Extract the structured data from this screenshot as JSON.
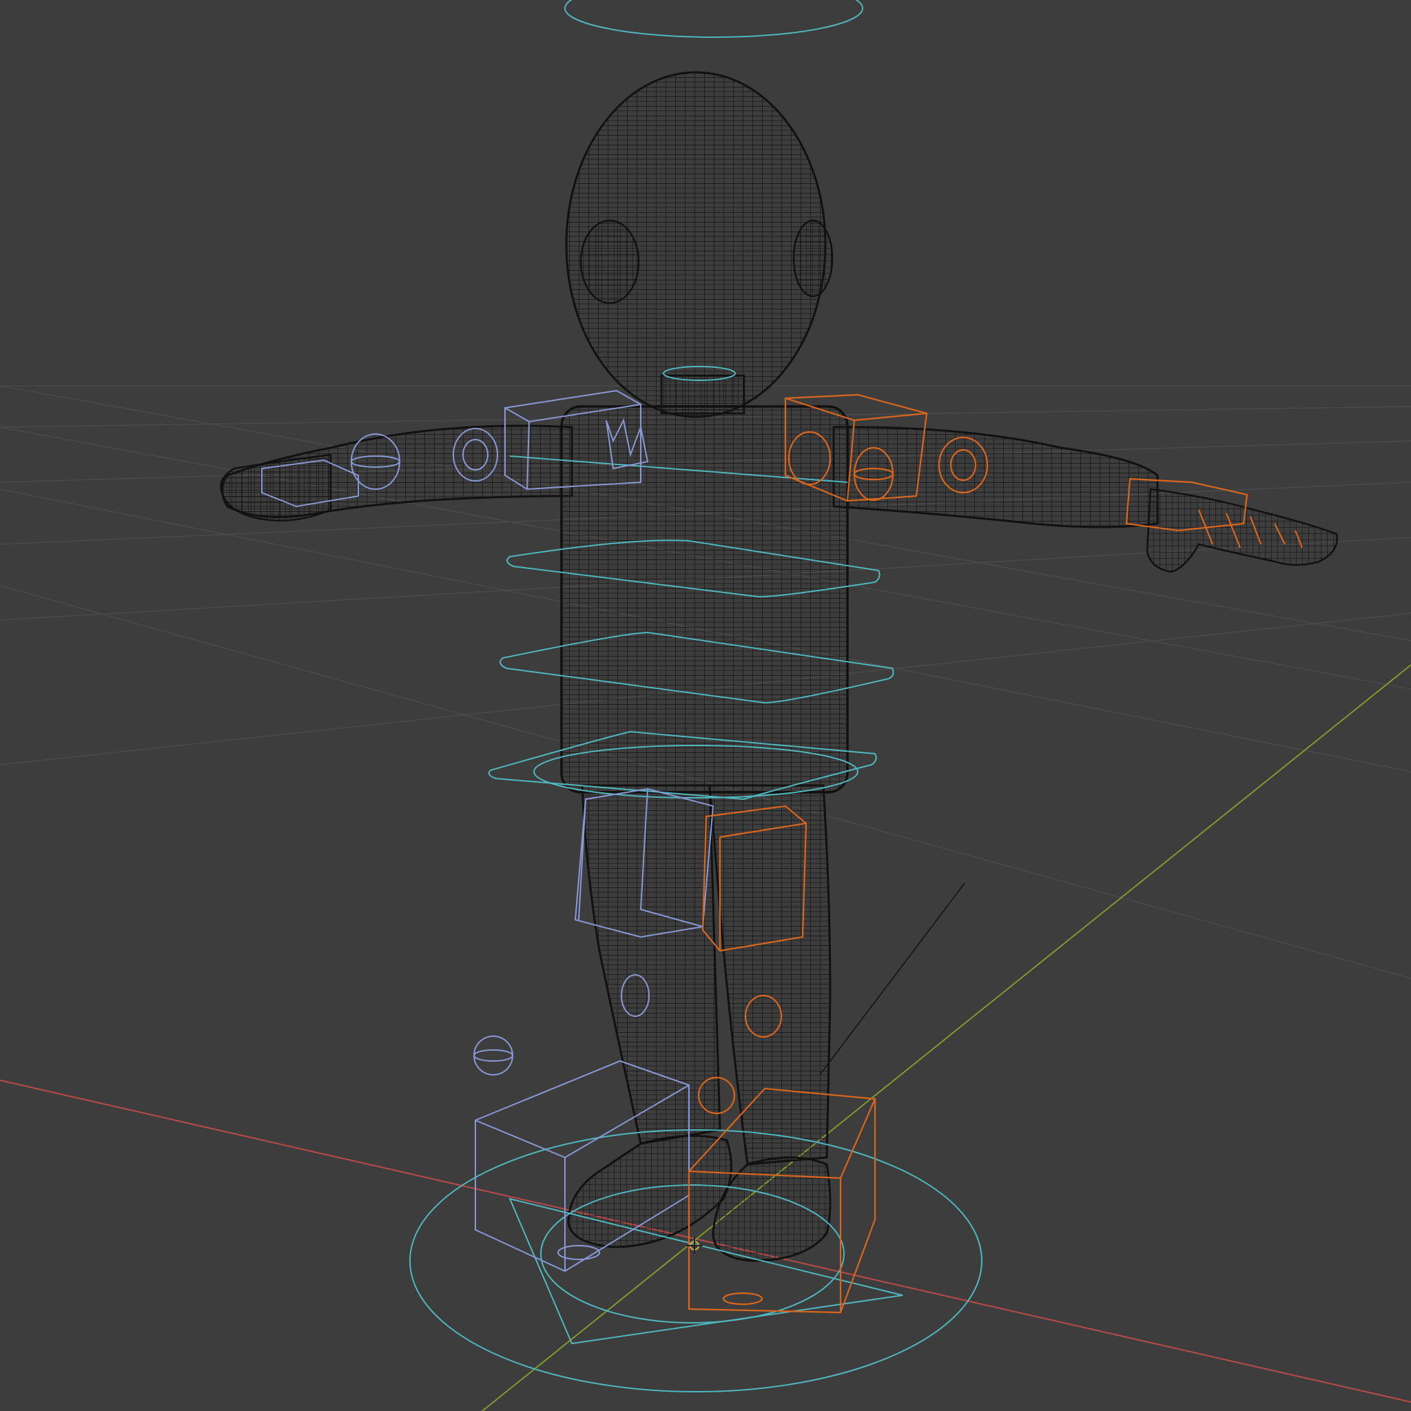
{
  "viewport": {
    "type": "3d-viewport",
    "shading": "wireframe",
    "background_color": "#3d3d3d"
  },
  "colors": {
    "grid": "#4a4a4a",
    "x_axis": "#b94a4a",
    "y_axis": "#7e9a2e",
    "mesh_wire": "#111111",
    "root_controls": "#4fb7bf",
    "left_controls": "#8899d6",
    "right_controls": "#d8661c"
  },
  "scene": {
    "object": "character-mesh",
    "pose": "t-pose",
    "rig": "control-rig"
  }
}
